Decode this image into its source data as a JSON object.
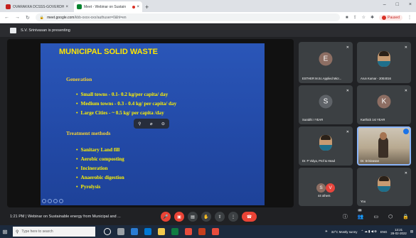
{
  "browser": {
    "tabs": [
      {
        "title": "OVARAKKA DCSSS-GOVERDHAN",
        "favicon_color": "#c5221f",
        "active": false
      },
      {
        "title": "Meet - Webinar on Sustain",
        "favicon_color": "#00832d",
        "active": true,
        "recording": true
      }
    ],
    "new_tab": "+",
    "window_controls": [
      "–",
      "□",
      "×"
    ],
    "address": {
      "host": "meet.google.com",
      "path": "/kbb-oxxx-oxx/authuser=0&hl=en"
    },
    "profile_label": "Paused"
  },
  "banner": {
    "text": "S.V. Srinivasan is presenting"
  },
  "slide": {
    "title": "MUNICIPAL SOLID WASTE",
    "generation_heading": "Generation",
    "generation_items": [
      "Small towns    - 0.1- 0.2 kg/per capita/ day",
      "Medium towns - 0.3 - 0.4 kg/ per capita/ day",
      "Large Cities    - ~ 0.5 kg/ per capita /day"
    ],
    "treatment_heading": "Treatment methods",
    "treatment_items": [
      "Sanitary Land fill",
      "Aerobic composting",
      "Incineration",
      "Anaerobic digestion",
      "Pyrolysis"
    ]
  },
  "participants": [
    {
      "name": "ESTHER M.Sc.Applied Micr...",
      "initial": "E",
      "color": "#8d6e63"
    },
    {
      "name": "Arun Kumar - 20E4016",
      "type": "photo"
    },
    {
      "name": "Surabhi I YEAR",
      "initial": "S",
      "color": "#5f6368"
    },
    {
      "name": "Karthick 1st YEAR",
      "initial": "K",
      "color": "#8d6e63"
    },
    {
      "name": "Dr. P Vidya, Prof & Head",
      "type": "photo"
    },
    {
      "name": "Dr. Srinivasan",
      "type": "video"
    },
    {
      "name": "44 others",
      "initials": [
        "S",
        "V"
      ],
      "colors": [
        "#8d6e63",
        "#e8453c"
      ]
    },
    {
      "name": "You",
      "type": "photo"
    }
  ],
  "meeting": {
    "time": "1:21 PM",
    "title": "Webinar on Sustainable energy from Municipal and ...",
    "participant_count": "46"
  },
  "taskbar": {
    "search_placeholder": "Type here to search",
    "weather": "32°C  Mostly sunny",
    "lang": "ENG",
    "time": "13:21",
    "date": "28-02-2022"
  }
}
